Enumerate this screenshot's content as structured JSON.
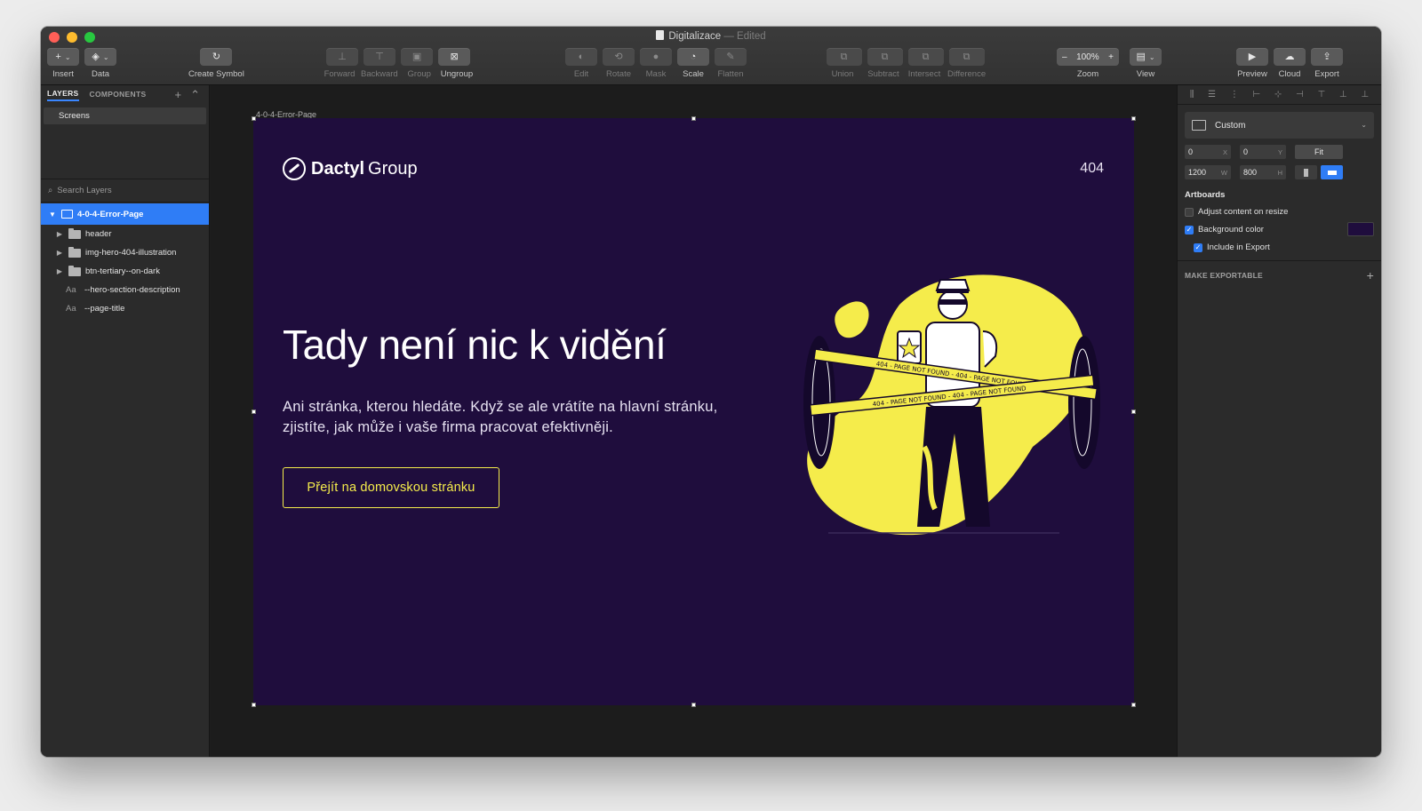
{
  "window": {
    "title": "Digitalizace",
    "status": "— Edited"
  },
  "toolbar": {
    "insert": "Insert",
    "data": "Data",
    "create_symbol": "Create Symbol",
    "forward": "Forward",
    "backward": "Backward",
    "group": "Group",
    "ungroup": "Ungroup",
    "edit": "Edit",
    "rotate": "Rotate",
    "mask": "Mask",
    "scale": "Scale",
    "flatten": "Flatten",
    "union": "Union",
    "subtract": "Subtract",
    "intersect": "Intersect",
    "difference": "Difference",
    "zoom_label": "Zoom",
    "zoom_value": "100%",
    "view": "View",
    "preview": "Preview",
    "cloud": "Cloud",
    "export": "Export"
  },
  "sidebar": {
    "tab_layers": "LAYERS",
    "tab_components": "COMPONENTS",
    "pages": [
      "Screens"
    ],
    "search_placeholder": "Search Layers",
    "layers": {
      "artboard": "4-0-4-Error-Page",
      "header": "header",
      "illustration": "img-hero-404-illustration",
      "button": "btn-tertiary--on-dark",
      "description": "--hero-section-description",
      "title": "--page-title",
      "text_icon": "Aa"
    }
  },
  "canvas": {
    "artboard_label": "4-0-4-Error-Page",
    "logo_bold": "Dactyl",
    "logo_light": "Group",
    "badge": "404",
    "title": "Tady není nic k vidění",
    "description": "Ani stránka, kterou hledáte. Když se ale vrátíte na hlavní stránku, zjistíte, jak může i vaše firma pracovat efektivněji.",
    "cta": "Přejít na domovskou stránku",
    "tape_text_1": "404 - PAGE NOT FOUND - 404 - PAGE NOT FOUND",
    "tape_text_2": "404 - PAGE NOT FOUND - 404 - PAGE NOT FOUND"
  },
  "inspector": {
    "preset": "Custom",
    "x": "0",
    "y": "0",
    "w": "1200",
    "h": "800",
    "x_suffix": "X",
    "y_suffix": "Y",
    "w_suffix": "W",
    "h_suffix": "H",
    "fit": "Fit",
    "section": "Artboards",
    "adjust": "Adjust content on resize",
    "bg_color": "Background color",
    "include_export": "Include in Export",
    "make_exportable": "MAKE EXPORTABLE"
  },
  "colors": {
    "accent": "#2f7df6",
    "artboard_bg": "#1f0d3d",
    "yellow": "#f5ec4b"
  },
  "icons": [
    "plus-icon",
    "data-icon",
    "create-symbol-icon",
    "forward-icon",
    "backward-icon",
    "group-icon",
    "ungroup-icon",
    "edit-icon",
    "rotate-icon",
    "mask-icon",
    "scale-icon",
    "flatten-icon",
    "union-icon",
    "subtract-icon",
    "intersect-icon",
    "difference-icon",
    "view-icon",
    "preview-icon",
    "cloud-icon",
    "export-icon",
    "search-icon",
    "artboard-icon",
    "folder-icon"
  ]
}
